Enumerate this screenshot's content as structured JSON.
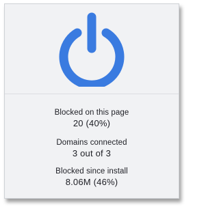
{
  "colors": {
    "accent": "#3a7be0",
    "panel_bg": "#f1f2f4",
    "text": "#1d1e24"
  },
  "power": {
    "icon": "power-icon",
    "state": "on"
  },
  "stats": [
    {
      "label": "Blocked on this page",
      "value": "20 (40%)"
    },
    {
      "label": "Domains connected",
      "value": "3 out of 3"
    },
    {
      "label": "Blocked since install",
      "value": "8.06M (46%)"
    }
  ]
}
